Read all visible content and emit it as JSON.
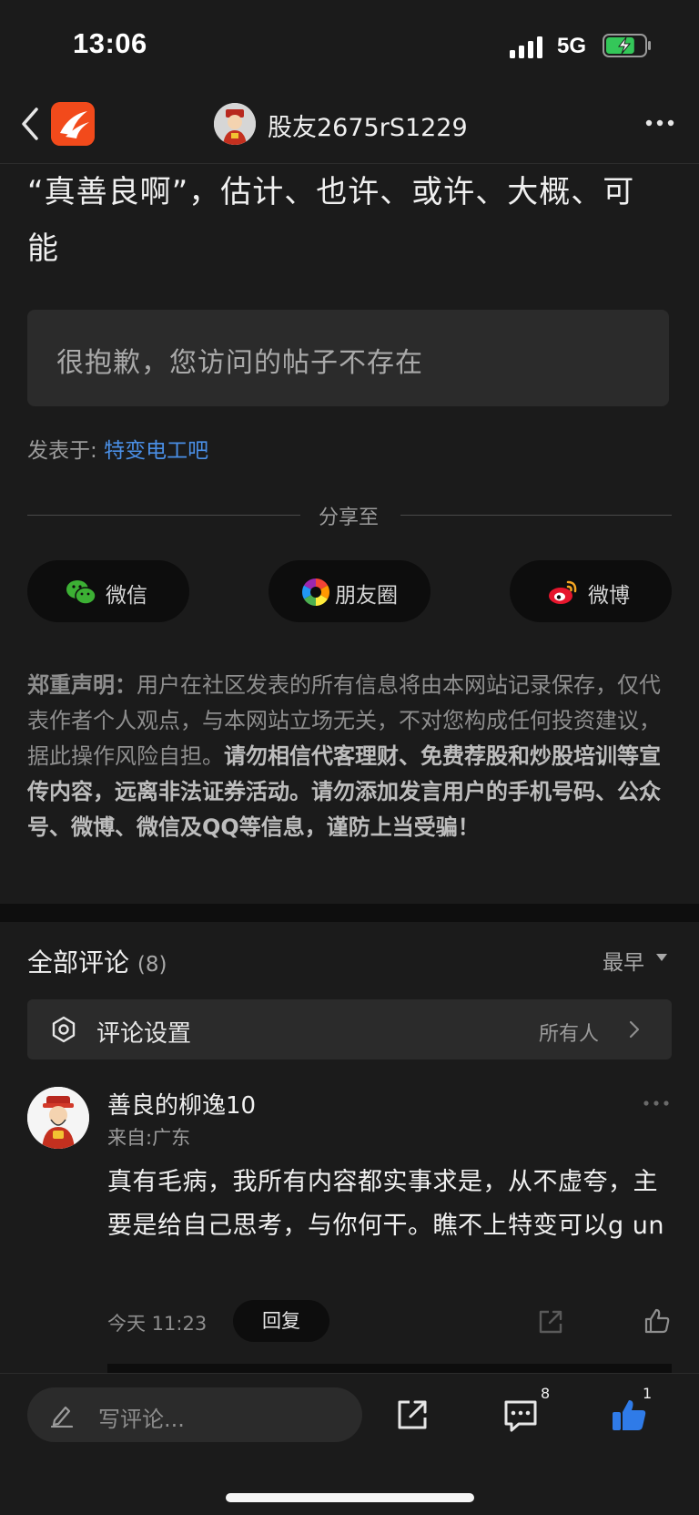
{
  "status_bar": {
    "time": "13:06",
    "network": "5G",
    "battery_level": 0.75
  },
  "nav": {
    "title": "股友2675rS1229",
    "back_icon": "chevron-left",
    "more_icon": "ellipsis"
  },
  "post": {
    "text": "“真善良啊”，估计、也许、或许、大概、可能",
    "not_found": "很抱歉，您访问的帖子不存在",
    "posted_in_label": "发表于: ",
    "posted_in_bar": "特变电工吧"
  },
  "share": {
    "label": "分享至",
    "wechat": "微信",
    "moments": "朋友圈",
    "weibo": "微博"
  },
  "disclaimer": {
    "title": "郑重声明：",
    "normal": "用户在社区发表的所有信息将由本网站记录保存，仅代表作者个人观点，与本网站立场无关，不对您构成任何投资建议，据此操作风险自担。",
    "strong": "请勿相信代客理财、免费荐股和炒股培训等宣传内容，远离非法证券活动。请勿添加发言用户的手机号码、公众号、微博、微信及QQ等信息，谨防上当受骗！"
  },
  "comments": {
    "title": "全部评论",
    "count": "(8)",
    "sort": "最早",
    "settings_label": "评论设置",
    "settings_value": "所有人",
    "items": [
      {
        "name": "善良的柳逸10",
        "location": "来自:广东",
        "text": "真有毛病，我所有内容都实事求是，从不虚夸，主要是给自己思考，与你何干。瞧不上特变可以g un",
        "time": "今天 11:23",
        "reply_label": "回复"
      }
    ]
  },
  "bottom_bar": {
    "input_placeholder": "写评论...",
    "comments_badge": "8",
    "likes_badge": "1"
  },
  "colors": {
    "accent_link": "#4a8fe6",
    "like_active": "#2f7be8",
    "app_logo": "#f24a1b"
  }
}
